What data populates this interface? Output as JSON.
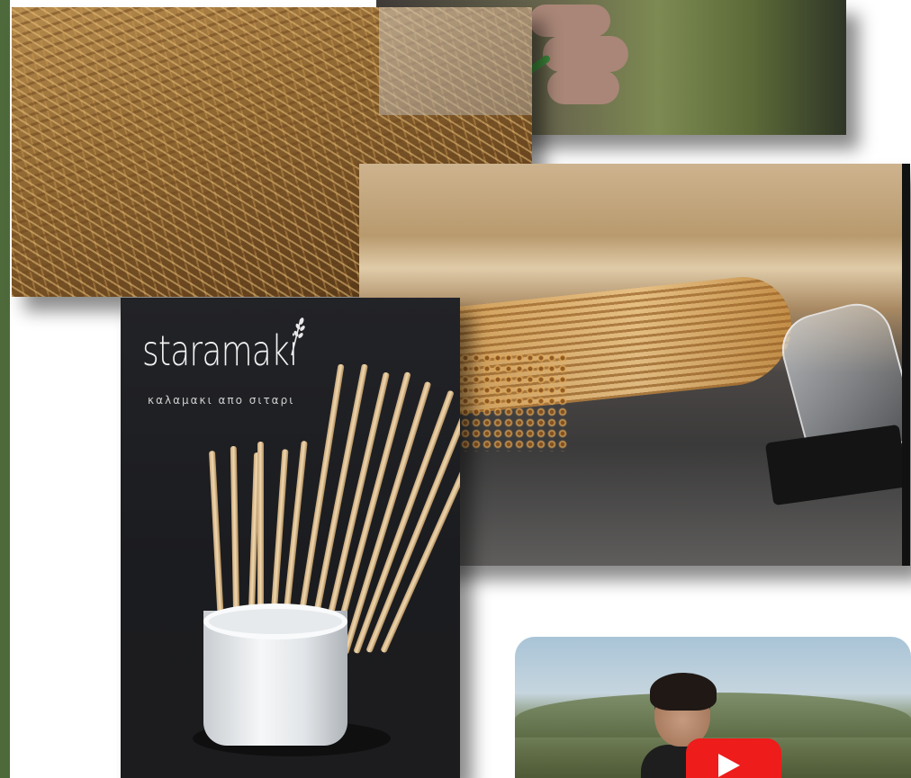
{
  "gallery": {
    "staramaki": {
      "brand": "staramaki",
      "tagline": "καλαμακι απο σιταρι"
    },
    "video": {
      "player": "youtube"
    }
  },
  "colors": {
    "rail": "#4e6a3b",
    "youtube_red": "#ee1c1b"
  },
  "icons": [
    "play-icon",
    "wheat-icon"
  ]
}
